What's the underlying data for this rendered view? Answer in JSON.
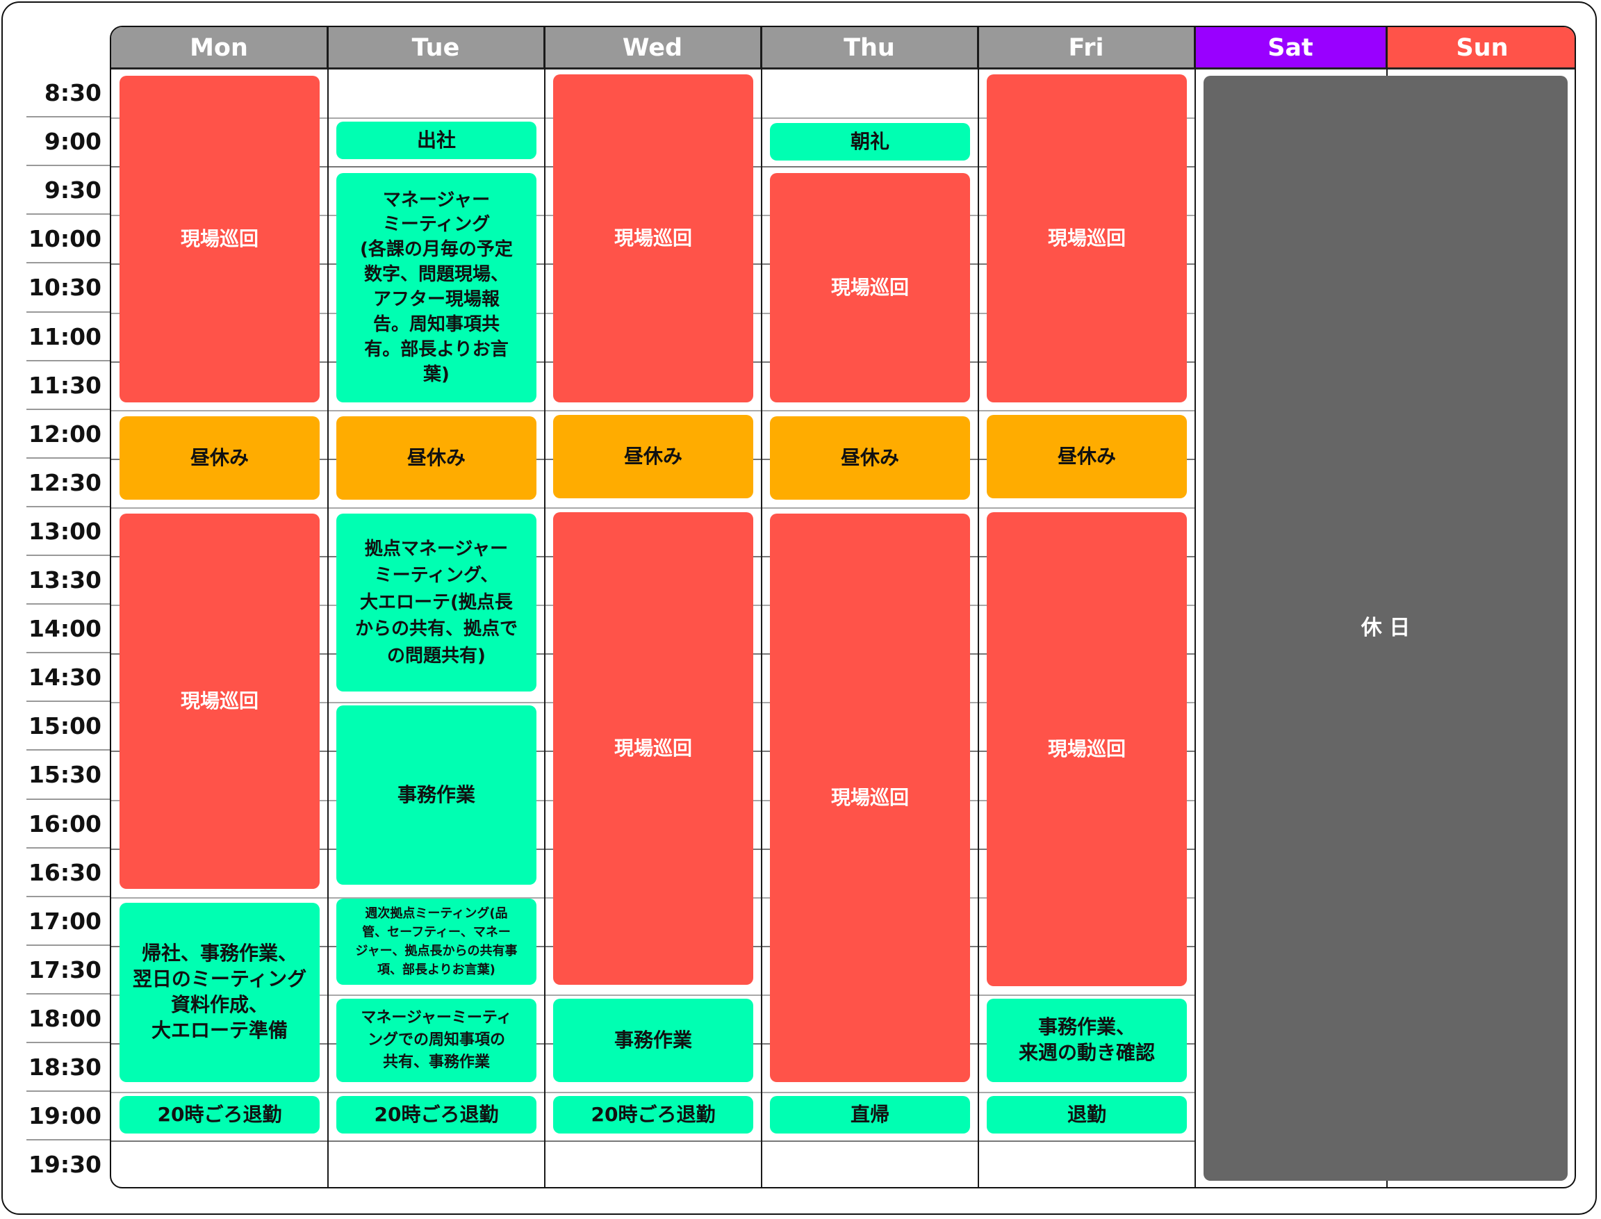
{
  "days": [
    "Mon",
    "Tue",
    "Wed",
    "Thu",
    "Fri",
    "Sat",
    "Sun"
  ],
  "header_colors": {
    "weekday": "#999999",
    "sat": "#9900FF",
    "sun": "#FF5349"
  },
  "event_colors": {
    "field": "#FF5349",
    "office": "#00FFB2",
    "lunch": "#FFAC00",
    "holiday": "#666666"
  },
  "times": [
    "8:30",
    "9:00",
    "9:30",
    "10:00",
    "10:30",
    "11:00",
    "11:30",
    "12:00",
    "12:30",
    "13:00",
    "13:30",
    "14:00",
    "14:30",
    "15:00",
    "15:30",
    "16:00",
    "16:30",
    "17:00",
    "17:30",
    "18:00",
    "18:30",
    "19:00",
    "19:30"
  ],
  "events": {
    "mon": {
      "patrol_am": "現場巡回",
      "lunch": "昼休み",
      "patrol_pm": "現場巡回",
      "evening_work": "帰社、事務作業、\n翌日のミーティング\n資料作成、\n大エローテ準備",
      "leave": "20時ごろ退勤"
    },
    "tue": {
      "arrive": "出社",
      "manager_meeting": "マネージャー\nミーティング\n(各課の月毎の予定\n数字、問題現場、\nアフター現場報\n告。周知事項共\n有。部長よりお言\n葉)",
      "lunch": "昼休み",
      "base_meeting": "拠点マネージャー\nミーティング、\n大エローテ(拠点長\nからの共有、拠点で\nの問題共有)",
      "office_work": "事務作業",
      "weekly_meeting": "週次拠点ミーティング(品\n管、セーフティー、マネー\nジャー、拠点長からの共有事\n項、部長よりお言葉)",
      "followup": "マネージャーミーティ\nングでの周知事項の\n共有、事務作業",
      "leave": "20時ごろ退勤"
    },
    "wed": {
      "patrol_am": "現場巡回",
      "lunch": "昼休み",
      "patrol_pm": "現場巡回",
      "office_work": "事務作業",
      "leave": "20時ごろ退勤"
    },
    "thu": {
      "morning_assembly": "朝礼",
      "patrol_am": "現場巡回",
      "lunch": "昼休み",
      "patrol_pm": "現場巡回",
      "direct_home": "直帰"
    },
    "fri": {
      "patrol_am": "現場巡回",
      "lunch": "昼休み",
      "patrol_pm": "現場巡回",
      "office_work": "事務作業、\n来週の動き確認",
      "leave": "退勤"
    },
    "weekend": {
      "holiday": "休 日"
    }
  }
}
